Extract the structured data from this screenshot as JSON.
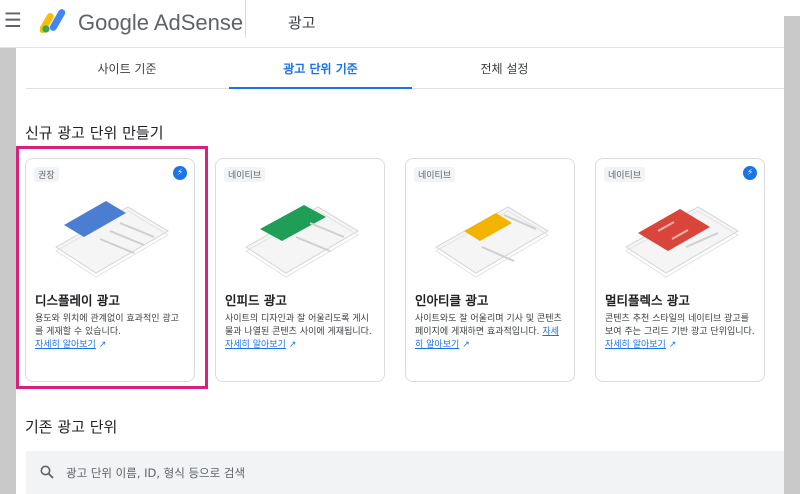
{
  "app": {
    "brand": "Google AdSense",
    "page_title": "광고"
  },
  "tabs": [
    {
      "label": "사이트 기준",
      "active": false
    },
    {
      "label": "광고 단위 기준",
      "active": true
    },
    {
      "label": "전체 설정",
      "active": false
    }
  ],
  "section_new": "신규 광고 단위 만들기",
  "cards": [
    {
      "badge": "권장",
      "bolt": true,
      "title": "디스플레이 광고",
      "desc": "용도와 위치에 관계없이 효과적인 광고를 게재할 수 있습니다.",
      "learn": "자세히 알아보기",
      "color": "#4a7ed2"
    },
    {
      "badge": "네이티브",
      "bolt": false,
      "title": "인피드 광고",
      "desc": "사이트의 디자인과 잘 어울리도록 게시물과 나열된 콘텐츠 사이에 게재됩니다.",
      "learn": "자세히 알아보기",
      "color": "#1e9e57"
    },
    {
      "badge": "네이티브",
      "bolt": false,
      "title": "인아티클 광고",
      "desc": "사이트와도 잘 어울리며 기사 및 콘텐츠 페이지에 게재하면 효과적입니다.",
      "learn": "자세히 알아보기",
      "color": "#f2b400"
    },
    {
      "badge": "네이티브",
      "bolt": true,
      "title": "멀티플렉스 광고",
      "desc": "콘텐츠 추천 스타일의 네이티브 광고를 보여 주는 그리드 기반 광고 단위입니다.",
      "learn": "자세히 알아보기",
      "color": "#d9443b"
    }
  ],
  "section_existing": "기존 광고 단위",
  "search": {
    "placeholder": "광고 단위 이름, ID, 형식 등으로 검색"
  },
  "colors": {
    "accent": "#1a73e8",
    "highlight": "#d7227c"
  },
  "icons": [
    "menu-icon",
    "adsense-logo",
    "bolt-icon",
    "external-link-icon",
    "search-icon"
  ]
}
